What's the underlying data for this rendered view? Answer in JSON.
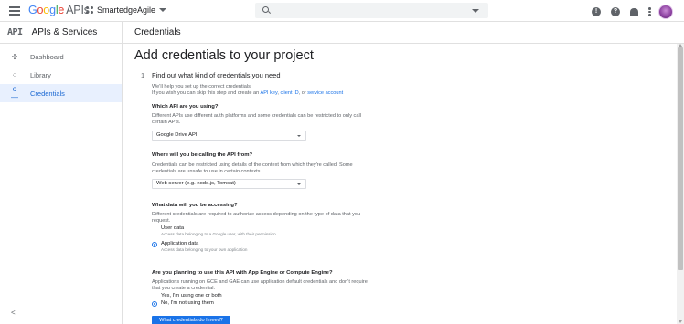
{
  "topbar": {
    "logo_g": "G",
    "logo_o1": "o",
    "logo_o2": "o",
    "logo_g2": "g",
    "logo_l": "l",
    "logo_e": "e",
    "logo_apis": "APIs",
    "project_name": "SmartedgeAgile",
    "search_placeholder": ""
  },
  "sidebar": {
    "badge": "API",
    "title": "APIs & Services",
    "items": [
      {
        "label": "Dashboard",
        "icon": "dashboard-icon",
        "active": false
      },
      {
        "label": "Library",
        "icon": "library-icon",
        "active": false
      },
      {
        "label": "Credentials",
        "icon": "key-icon",
        "active": true
      }
    ],
    "collapse": "<|"
  },
  "main": {
    "header": "Credentials",
    "page_title": "Add credentials to your project",
    "step_number": "1",
    "step_title": "Find out what kind of credentials you need",
    "intro_1": "We'll help you set up the correct credentials",
    "intro_2_prefix": "If you wish you can skip this step and create an ",
    "intro_link_api_key": "API key",
    "intro_sep1": ", ",
    "intro_link_client_id": "client ID",
    "intro_sep2": ", or ",
    "intro_link_service_account": "service account",
    "q1": {
      "label": "Which API are you using?",
      "desc": "Different APIs use different auth platforms and some credentials can be restricted to only call certain APIs.",
      "selected": "Google Drive API"
    },
    "q2": {
      "label": "Where will you be calling the API from?",
      "desc": "Credentials can be restricted using details of the context from which they're called. Some credentials are unsafe to use in certain contexts.",
      "selected": "Web server (e.g. node.js, Tomcat)"
    },
    "q3": {
      "label": "What data will you be accessing?",
      "desc": "Different credentials are required to authorize access depending on the type of data that you request.",
      "options": [
        {
          "label": "User data",
          "sub": "Access data belonging to a Google user, with their permission",
          "checked": false
        },
        {
          "label": "Application data",
          "sub": "Access data belonging to your own application",
          "checked": true
        }
      ]
    },
    "q4": {
      "label": "Are you planning to use this API with App Engine or Compute Engine?",
      "desc": "Applications running on GCE and GAE can use application default credentials and don't require that you create a credential.",
      "options": [
        {
          "label": "Yes, I'm using one or both",
          "checked": false
        },
        {
          "label": "No, I'm not using them",
          "checked": true
        }
      ]
    },
    "button": "What credentials do I need?"
  },
  "colors": {
    "accent": "#1a73e8",
    "active_bg": "#e8f0fe",
    "text": "#202124",
    "muted": "#5f6368"
  }
}
